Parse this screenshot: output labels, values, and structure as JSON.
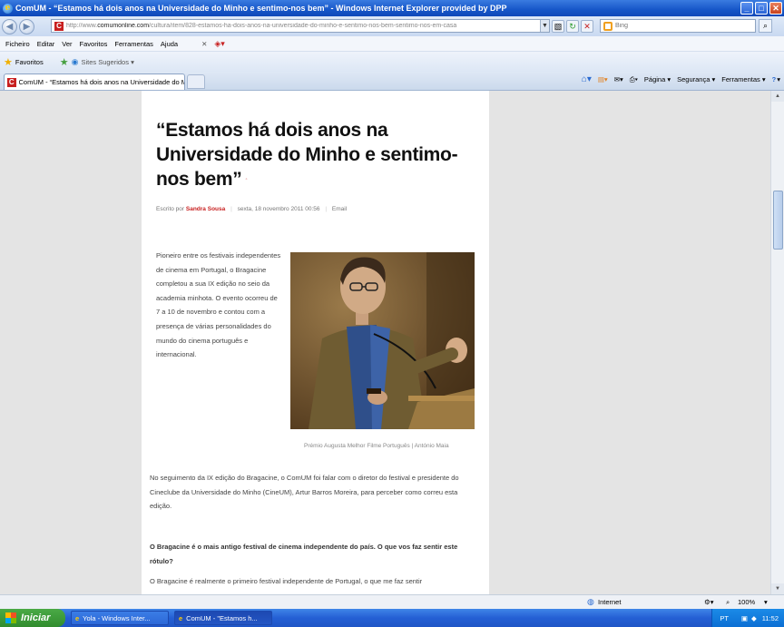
{
  "window": {
    "title": "ComUM - “Estamos há dois anos na Universidade do Minho e sentimo-nos bem” - Windows Internet Explorer provided by DPP",
    "minimize_label": "_",
    "maximize_label": "□",
    "close_label": "✕"
  },
  "address": {
    "url_prefix": "http://www.",
    "url_domain": "comumonline.com",
    "url_rest": "/cultura/item/828-estamos-ha-dois-anos-na-universidade-do-minho-e-sentimo-nos-bem-sentimo-nos-em-casa",
    "search_placeholder": "Bing"
  },
  "menu": {
    "items": [
      "Ficheiro",
      "Editar",
      "Ver",
      "Favoritos",
      "Ferramentas",
      "Ajuda"
    ],
    "close_label": "✕"
  },
  "favorites_bar": {
    "favorites_label": "Favoritos",
    "suggested_label": "Sites Sugeridos ▾"
  },
  "tabs": [
    {
      "label": "ComUM - “Estamos há dois anos na Universidade do M..."
    }
  ],
  "command_bar": {
    "page_label": "Página ▾",
    "security_label": "Segurança ▾",
    "tools_label": "Ferramentas ▾",
    "help_label": "▾"
  },
  "article": {
    "headline": "“Estamos há dois anos na Universidade do Minho e sentimo-nos bem”",
    "byline_prefix": "Escrito por",
    "author": "Sandra Sousa",
    "date": "sexta, 18 novembro 2011 00:56",
    "email_label": "Email",
    "intro": "Pioneiro entre os festivais independentes de cinema em Portugal, o Bragacine completou a sua IX edição no seio da academia minhota. O evento ocorreu de 7 a 10 de novembro e contou com a presença de várias personalidades do mundo do cinema português e internacional.",
    "photo_caption": "Prémio Augusta Melhor Filme Português | António Maia",
    "para1": "No seguimento da IX edição do Bragacine, o ComUM foi falar com o diretor do festival e presidente do Cineclube da Universidade do Minho (CineUM), Artur Barros Moreira, para perceber como correu esta edição.",
    "question1": "O Bragacine é o mais antigo festival de cinema independente do país. O que vos faz sentir este rótulo?",
    "answer1": "O Bragacine é realmente o primeiro festival independente de Portugal, o que me faz sentir"
  },
  "status": {
    "zone_label": "Internet",
    "zoom": "100%"
  },
  "taskbar": {
    "start_label": "Iniciar",
    "items": [
      "Yola - Windows Inter...",
      "ComUM - \"Estamos h..."
    ],
    "lang": "PT",
    "clock": "11:52"
  },
  "colors": {
    "accent": "#c82020",
    "titlebar": "#1656c8",
    "taskbar": "#245fd4",
    "start": "#318c2e"
  }
}
